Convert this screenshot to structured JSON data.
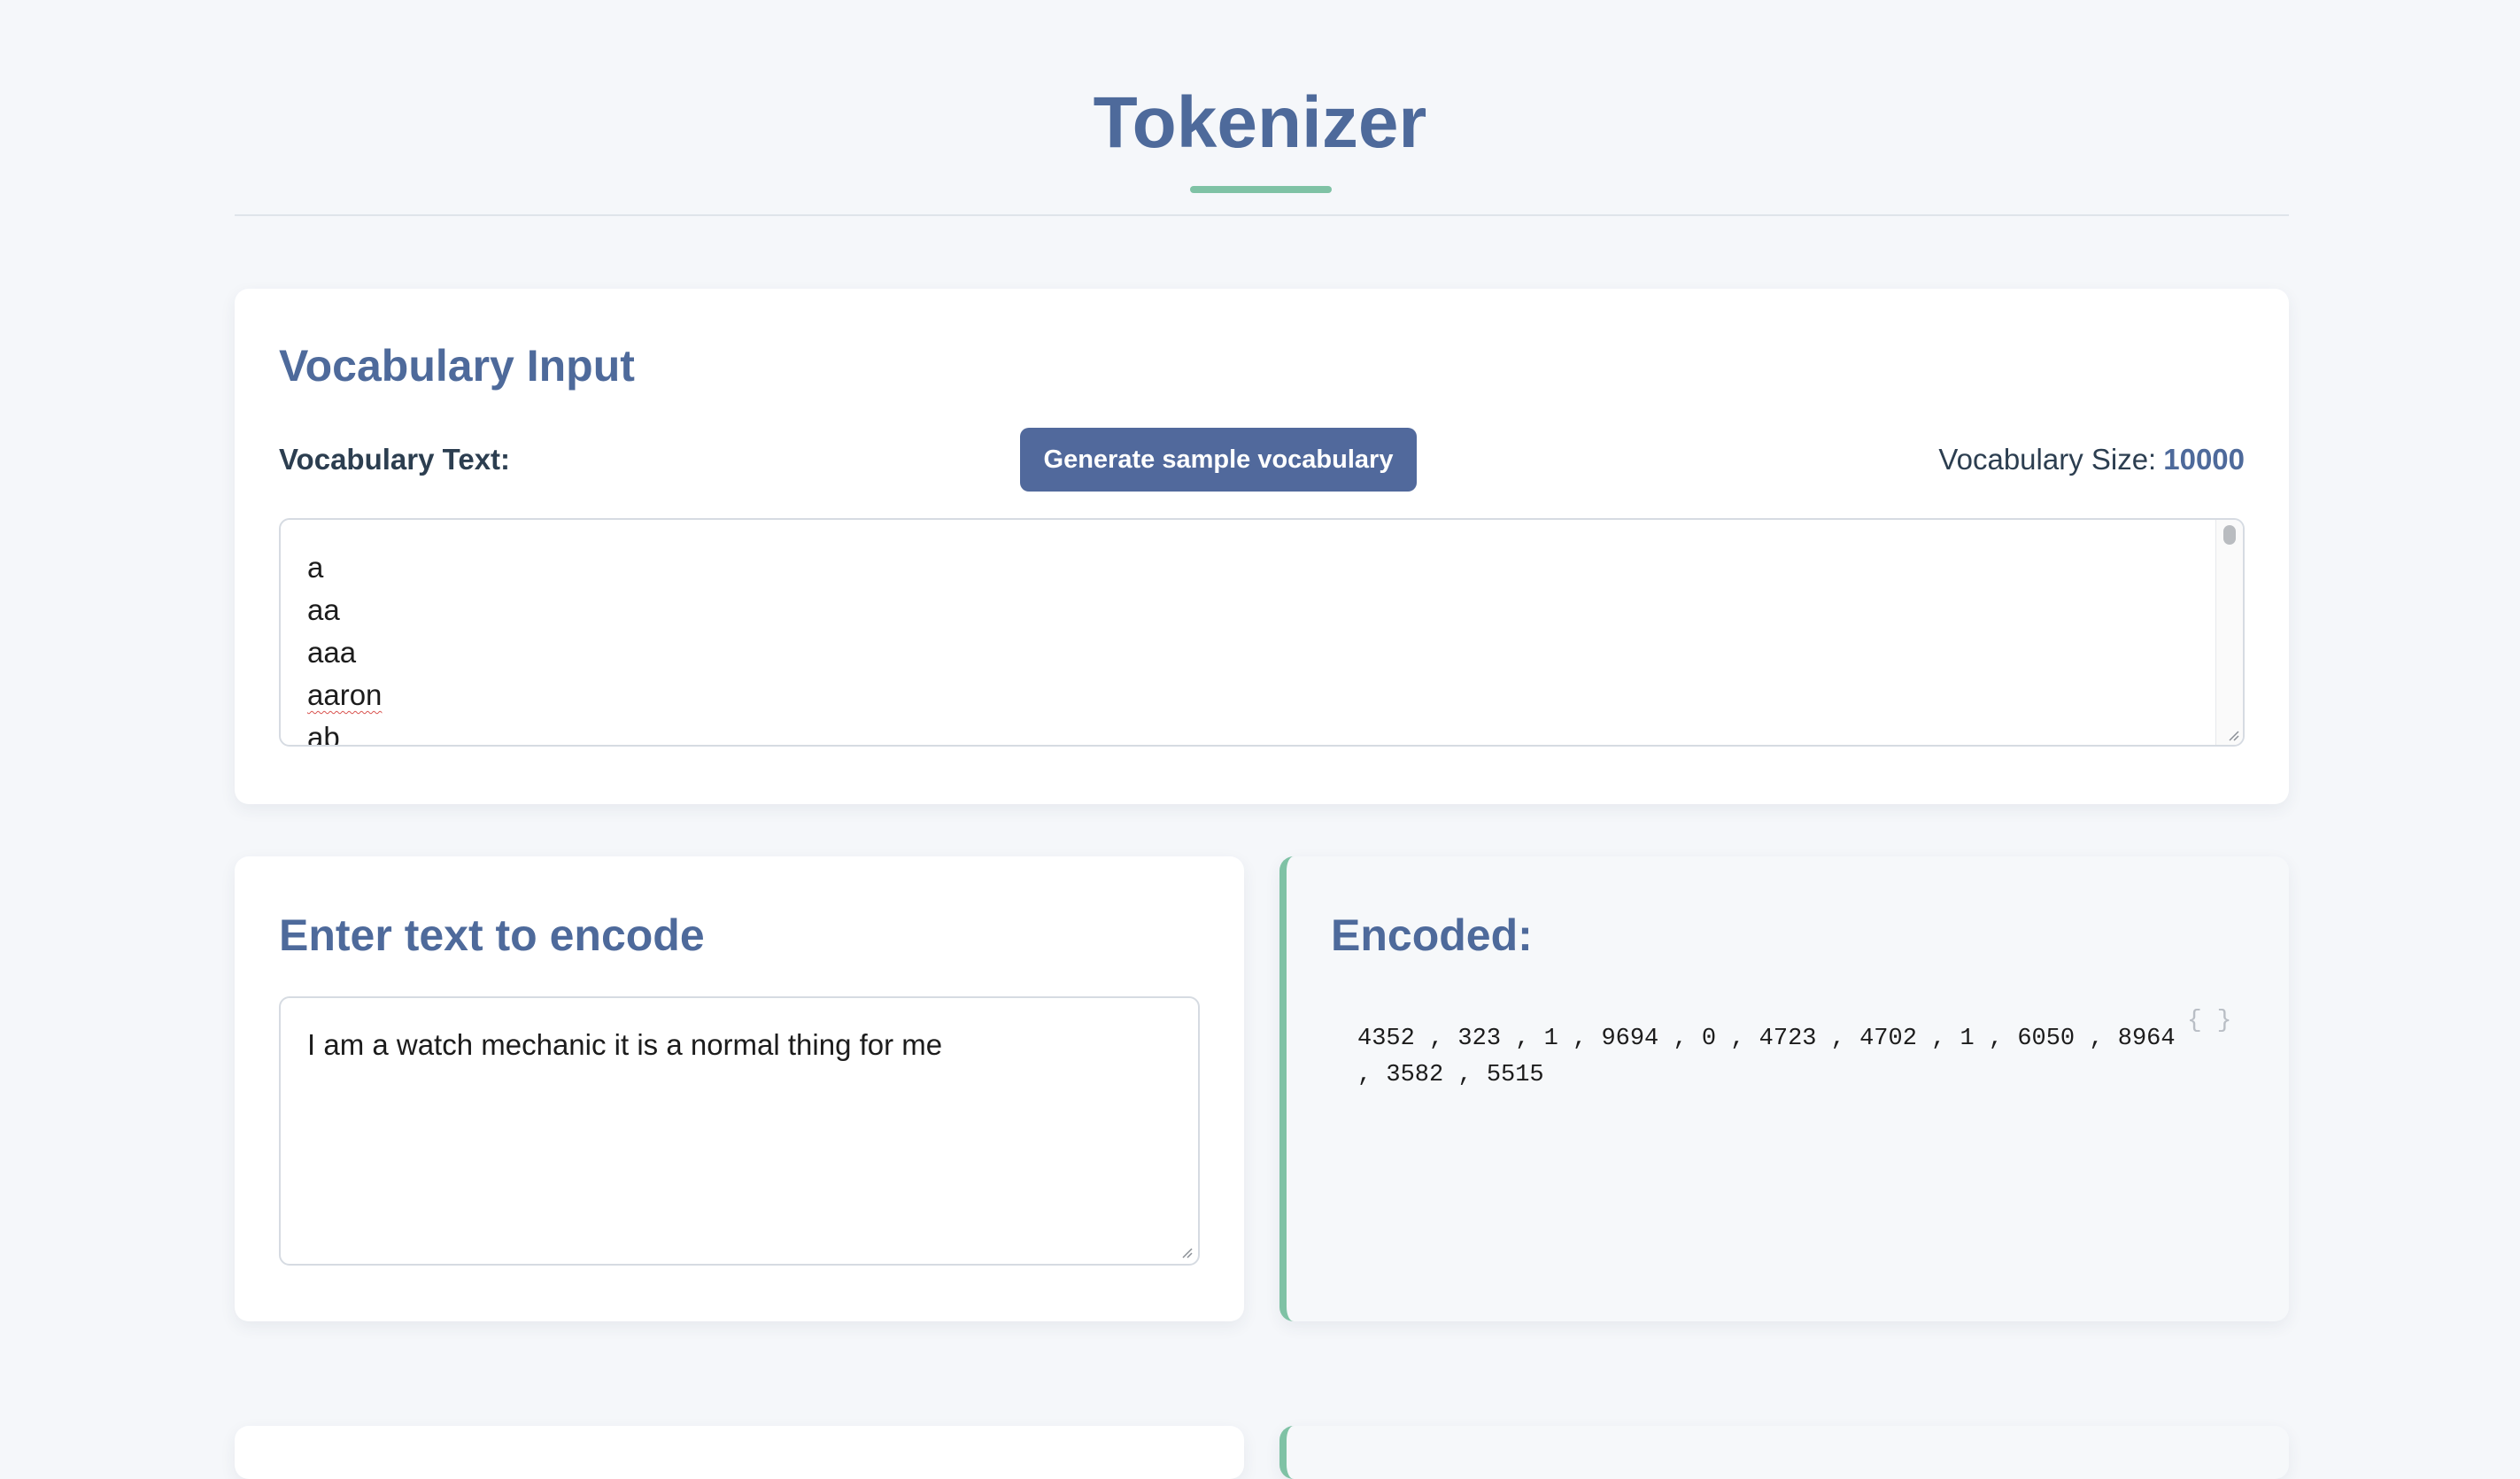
{
  "header": {
    "title": "Tokenizer"
  },
  "vocabulary": {
    "heading": "Vocabulary Input",
    "text_label": "Vocabulary Text:",
    "generate_button": "Generate sample vocabulary",
    "size_label": "Vocabulary Size:",
    "size_value": "10000",
    "visible_lines": [
      "a",
      "aa",
      "aaa",
      "aaron",
      "ab"
    ]
  },
  "encode": {
    "heading": "Enter text to encode",
    "input_value": "I am a watch mechanic it is a normal thing for me"
  },
  "encoded": {
    "heading": "Encoded:",
    "output": "4352 , 323 , 1 , 9694 , 0 , 4723 , 4702 , 1 , 6050 , 8964 , 3582 , 5515",
    "copy_icon": "{ }"
  },
  "colors": {
    "accent": "#4e6a9b",
    "button": "#51699c",
    "highlight": "#7fc2a5",
    "background": "#f5f7fa"
  }
}
